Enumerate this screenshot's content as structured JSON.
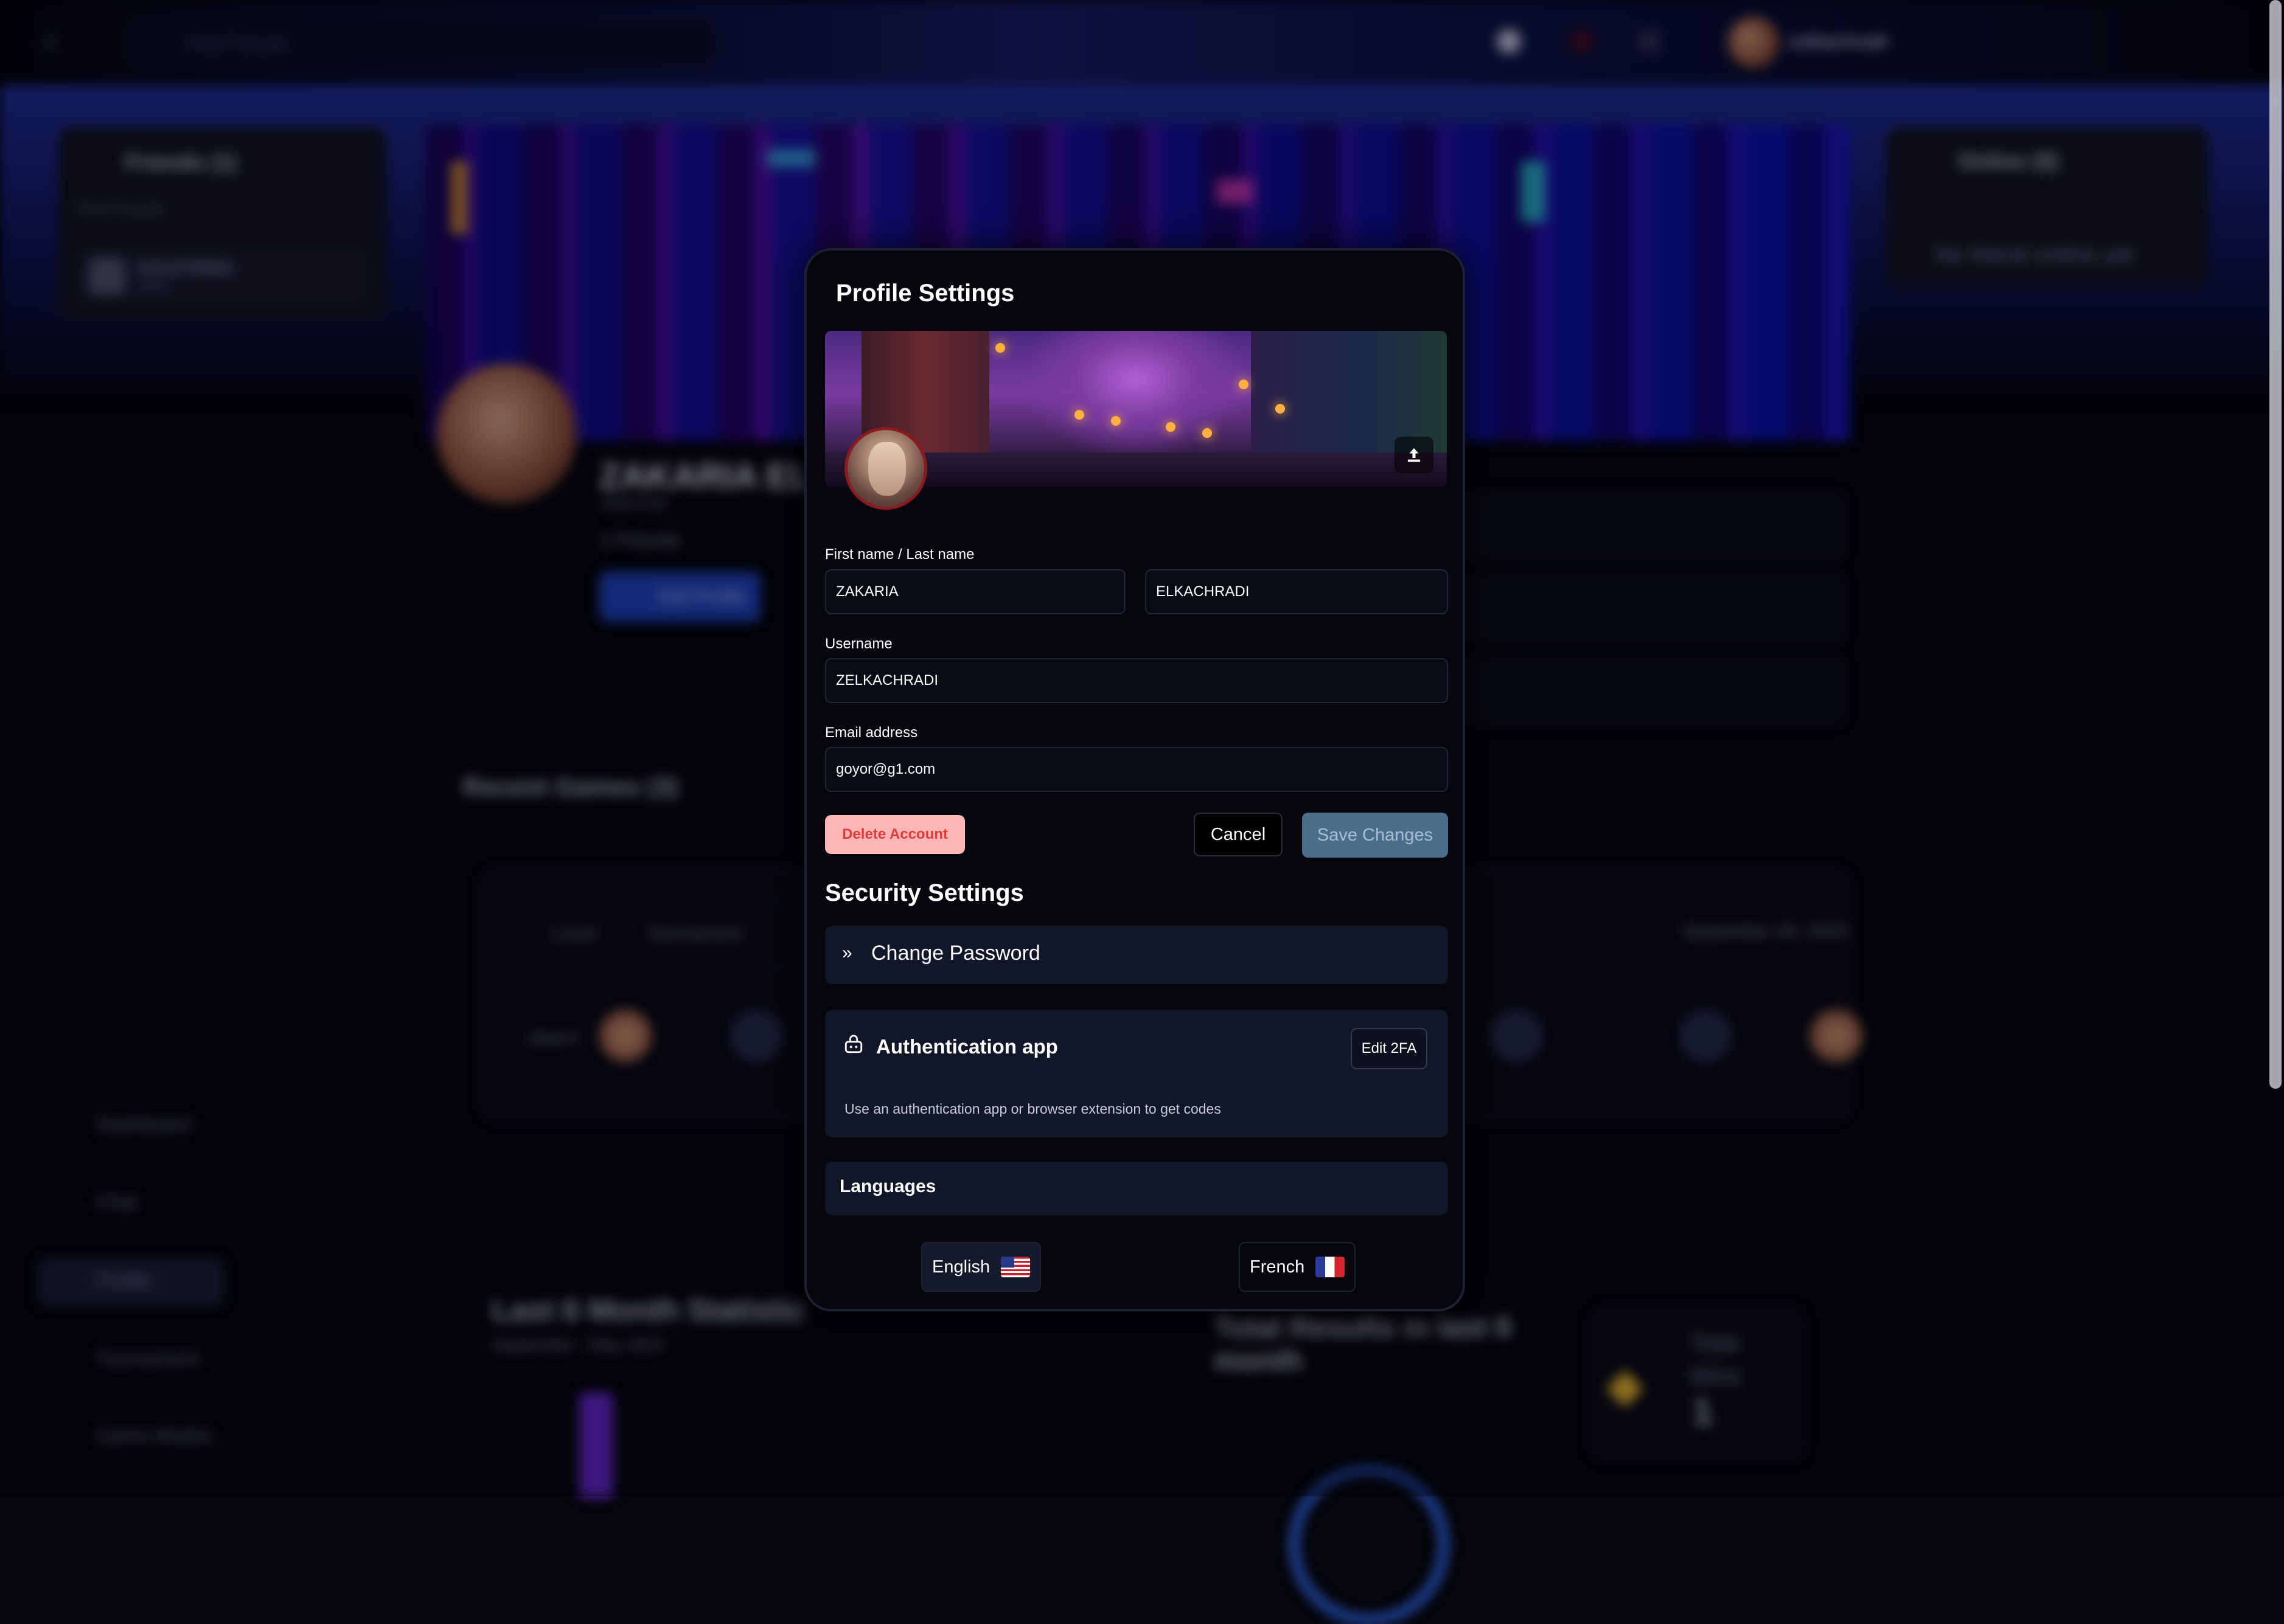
{
  "background": {
    "search_placeholder": "Find Friends",
    "username": "zelkachradi",
    "friends_title": "Friends (1)",
    "friends_search": "Find Friends",
    "friend_name": "Achraf Mellas",
    "friend_status": "offline",
    "online_title": "Online (0)",
    "online_empty": "No friend online yet",
    "profile_name": "ZAKARIA ELKA",
    "profile_handle": "zelkachradi",
    "friends_count": "1 Friends",
    "edit_profile": "Edit Profile",
    "recent_games": "Recent Games (3)",
    "games_tabs": [
      "Local",
      "Tournament"
    ],
    "games_date": "September 30, 2024",
    "games_player": "player1",
    "sidebar": [
      "Dashboard",
      "Chat",
      "Profile",
      "Tournament",
      "Game Modes"
    ],
    "stats_title": "Last 6 Month Statistic",
    "stats_sub": "September - May 2024",
    "results_title": "Total Results in last 6 month",
    "wins_label": "Total Wins",
    "wins_value": "1"
  },
  "modal": {
    "title": "Profile Settings",
    "name_label": "First name / Last name",
    "first_name": "ZAKARIA",
    "last_name": "ELKACHRADI",
    "username_label": "Username",
    "username": "ZELKACHRADI",
    "email_label": "Email address",
    "email": "goyor@g1.com",
    "delete_label": "Delete Account",
    "cancel_label": "Cancel",
    "save_label": "Save Changes",
    "security_title": "Security Settings",
    "change_password": "Change Password",
    "auth_title": "Authentication app",
    "edit_2fa": "Edit 2FA",
    "auth_desc": "Use an authentication app or browser extension to get codes",
    "languages_title": "Languages",
    "languages": [
      "English",
      "French"
    ]
  },
  "colors": {
    "accent_blue": "#2246c8",
    "delete_bg": "#fdb6b6",
    "delete_text": "#e03a3a",
    "save_bg": "#4a6f8c",
    "card_bg": "#111728"
  }
}
